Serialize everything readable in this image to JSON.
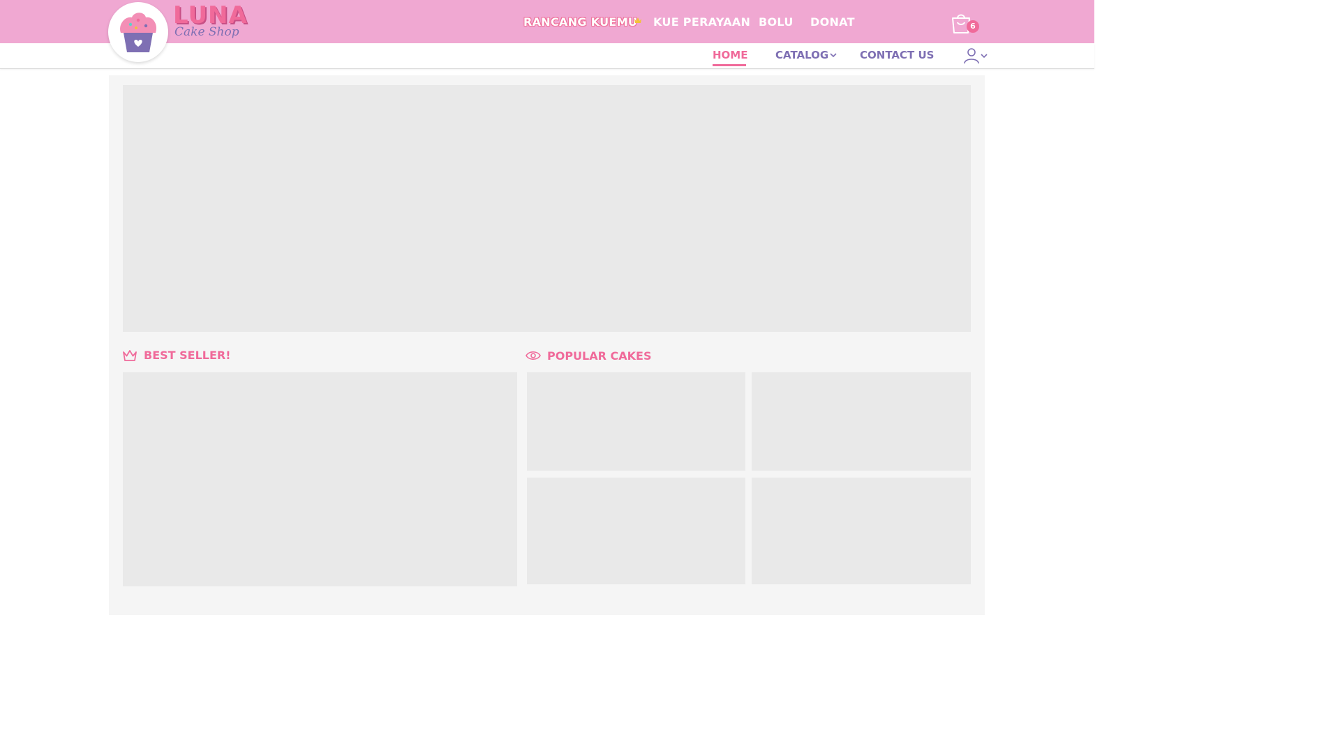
{
  "brand": {
    "name": "LUNA",
    "tagline": "Cake Shop",
    "logo_icon": "cupcake-icon"
  },
  "top_nav": {
    "items": [
      {
        "label": "RANCANG KUEMU",
        "badge_icon": "crown-icon"
      },
      {
        "label": "KUE PERAYAAN"
      },
      {
        "label": "BOLU"
      },
      {
        "label": "DONAT"
      }
    ],
    "cart": {
      "icon": "shopping-bag-icon",
      "count": "6"
    }
  },
  "sub_nav": {
    "items": [
      {
        "label": "HOME",
        "active": true
      },
      {
        "label": "CATALOG",
        "icon": "chevron-down-icon"
      },
      {
        "label": "CONTACT US"
      }
    ],
    "account_icon": "user-icon"
  },
  "sections": {
    "best_seller": {
      "title": "BEST SELLER!",
      "icon": "crown-icon"
    },
    "popular": {
      "title": "POPULAR CAKES",
      "icon": "eye-icon"
    }
  },
  "colors": {
    "header_pink": "#f0a8d2",
    "accent_pink": "#f06a9a",
    "purple": "#7e6fb3",
    "placeholder_gray": "#e9e9e9",
    "content_bg": "#f5f5f5"
  }
}
